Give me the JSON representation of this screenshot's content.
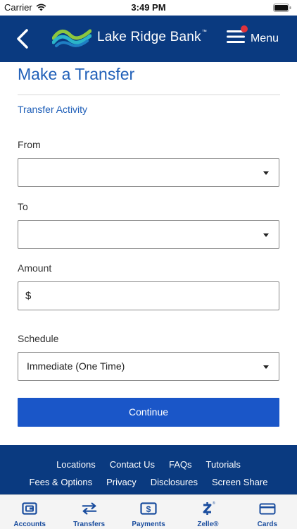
{
  "status_bar": {
    "carrier": "Carrier",
    "time": "3:49 PM"
  },
  "header": {
    "brand": "Lake Ridge Bank",
    "trademark": "™",
    "menu_label": "Menu",
    "colors": {
      "navy": "#0a3a80",
      "notification_dot": "#e0333c"
    }
  },
  "page": {
    "title": "Make a Transfer",
    "activity_link": "Transfer Activity",
    "from": {
      "label": "From",
      "value": ""
    },
    "to": {
      "label": "To",
      "value": ""
    },
    "amount": {
      "label": "Amount",
      "currency": "$",
      "value": ""
    },
    "schedule": {
      "label": "Schedule",
      "value": "Immediate (One Time)"
    },
    "continue_label": "Continue",
    "accent_color": "#1a56c8"
  },
  "footer": {
    "row1": [
      "Locations",
      "Contact Us",
      "FAQs",
      "Tutorials"
    ],
    "row2": [
      "Fees & Options",
      "Privacy",
      "Disclosures",
      "Screen Share"
    ]
  },
  "tab_bar": [
    {
      "label": "Accounts",
      "icon": "wallet-icon"
    },
    {
      "label": "Transfers",
      "icon": "transfer-arrows-icon"
    },
    {
      "label": "Payments",
      "icon": "dollar-bill-icon"
    },
    {
      "label": "Zelle®",
      "icon": "zelle-icon"
    },
    {
      "label": "Cards",
      "icon": "credit-card-icon"
    }
  ]
}
